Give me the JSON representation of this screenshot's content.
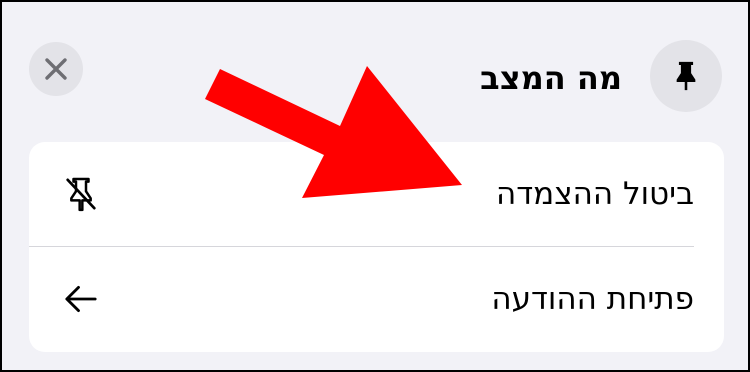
{
  "sheet": {
    "title": "מה המצב"
  },
  "header": {
    "close_icon": "close-icon",
    "pin_icon": "pin-icon"
  },
  "menu": {
    "items": [
      {
        "label": "ביטול ההצמדה",
        "icon": "unpin-icon"
      },
      {
        "label": "פתיחת ההודעה",
        "icon": "arrow-left-icon"
      }
    ]
  },
  "annotation": {
    "color": "#ff0000"
  }
}
